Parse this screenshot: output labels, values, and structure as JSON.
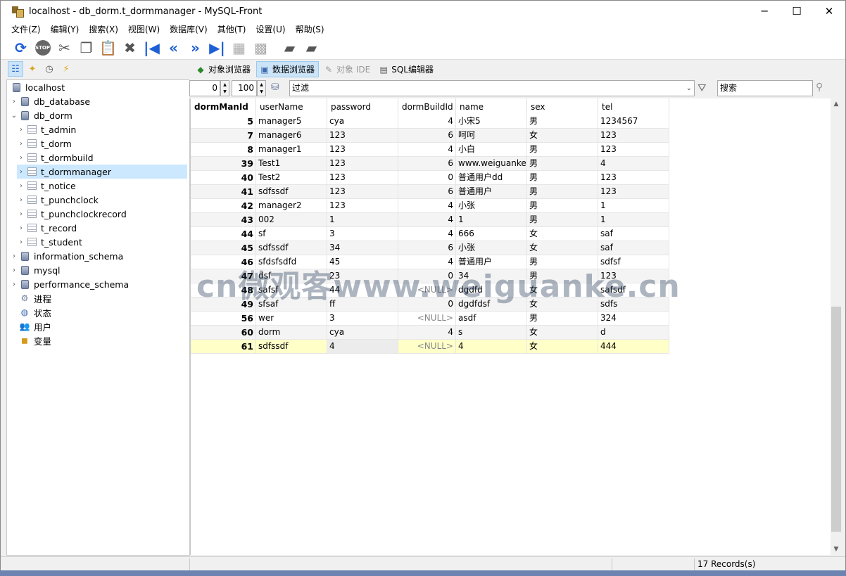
{
  "window": {
    "title": "localhost - db_dorm.t_dormmanager - MySQL-Front",
    "minimize": "─",
    "maximize": "☐",
    "close": "✕"
  },
  "menu": [
    "文件(Z)",
    "编辑(Y)",
    "搜索(X)",
    "视图(W)",
    "数据库(V)",
    "其他(T)",
    "设置(U)",
    "帮助(S)"
  ],
  "toolbar": {
    "icons": [
      "refresh-icon",
      "stop-icon",
      "cut-icon",
      "copy-icon",
      "paste-icon",
      "delete-icon",
      "first-record-icon",
      "previous-record-icon",
      "next-record-icon",
      "last-record-icon",
      "insert-record-icon",
      "delete-record-icon",
      "post-icon",
      "cancel-icon"
    ],
    "stop_label": "STOP"
  },
  "view_tabs": [
    "对象浏览器",
    "数据浏览器",
    "对象 IDE",
    "SQL编辑器"
  ],
  "tree": {
    "nodes": [
      {
        "label": "localhost"
      },
      {
        "label": "db_database"
      },
      {
        "label": "db_dorm"
      },
      {
        "label": "t_admin"
      },
      {
        "label": "t_dorm"
      },
      {
        "label": "t_dormbuild"
      },
      {
        "label": "t_dormmanager"
      },
      {
        "label": "t_notice"
      },
      {
        "label": "t_punchclock"
      },
      {
        "label": "t_punchclockrecord"
      },
      {
        "label": "t_record"
      },
      {
        "label": "t_student"
      },
      {
        "label": "information_schema"
      },
      {
        "label": "mysql"
      },
      {
        "label": "performance_schema"
      },
      {
        "label": "进程"
      },
      {
        "label": "状态"
      },
      {
        "label": "用户"
      },
      {
        "label": "变量"
      }
    ]
  },
  "filter": {
    "offset": "0",
    "limit": "100",
    "filter_placeholder": "过滤",
    "search_placeholder": "搜索"
  },
  "grid": {
    "columns": [
      "dormManId",
      "userName",
      "password",
      "dormBuildId",
      "name",
      "sex",
      "tel"
    ],
    "rows": [
      [
        "5",
        "manager5",
        "cya",
        "4",
        "小宋5",
        "男",
        "1234567"
      ],
      [
        "7",
        "manager6",
        "123",
        "6",
        "呵呵",
        "女",
        "123"
      ],
      [
        "8",
        "manager1",
        "123",
        "4",
        "小白",
        "男",
        "123"
      ],
      [
        "39",
        "Test1",
        "123",
        "6",
        "www.weiguanke.cn",
        "男",
        "4"
      ],
      [
        "40",
        "Test2",
        "123",
        "0",
        "普通用户dd",
        "男",
        "123"
      ],
      [
        "41",
        "sdfssdf",
        "123",
        "6",
        "普通用户",
        "男",
        "123"
      ],
      [
        "42",
        "manager2",
        "123",
        "4",
        "小张",
        "男",
        "1"
      ],
      [
        "43",
        "002",
        "1",
        "4",
        "1",
        "男",
        "1"
      ],
      [
        "44",
        "sf",
        "3",
        "4",
        "666",
        "女",
        "saf"
      ],
      [
        "45",
        "sdfssdf",
        "34",
        "6",
        "小张",
        "女",
        "saf"
      ],
      [
        "46",
        "sfdsfsdfd",
        "45",
        "4",
        "普通用户",
        "男",
        "sdfsf"
      ],
      [
        "47",
        "dsf",
        "23",
        "0",
        "34",
        "男",
        "123"
      ],
      [
        "48",
        "safsf",
        "44",
        "<NULL>",
        "dgdfd",
        "女",
        "safsdf"
      ],
      [
        "49",
        "sfsaf",
        "ff",
        "0",
        "dgdfdsf",
        "女",
        "sdfs"
      ],
      [
        "56",
        "wer",
        "3",
        "<NULL>",
        "asdf",
        "男",
        "324"
      ],
      [
        "60",
        "dorm",
        "cya",
        "4",
        "s",
        "女",
        "d"
      ],
      [
        "61",
        "sdfssdf",
        "4",
        "<NULL>",
        "4",
        "女",
        "444"
      ]
    ]
  },
  "status": {
    "records": "17 Records(s)"
  },
  "watermark": "cn微观客www.weiguanke.cn"
}
